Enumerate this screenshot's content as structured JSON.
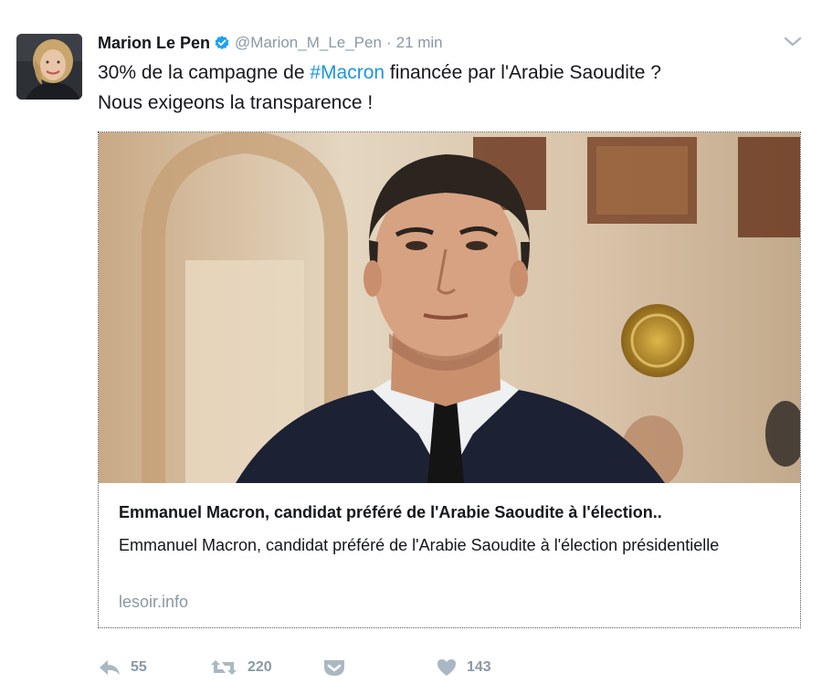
{
  "tweet": {
    "author_name": "Marion Le Pen",
    "handle": "@Marion_M_Le_Pen",
    "separator": "·",
    "time": "21 min",
    "text_before": "30% de la campagne de ",
    "hashtag": "#Macron",
    "text_line1_after": " financée par l'Arabie Saoudite ?",
    "text_line2": "Nous exigeons la transparence !"
  },
  "card": {
    "title": "Emmanuel Macron, candidat préféré de l'Arabie Saoudite à l'élection..",
    "description": "Emmanuel Macron, candidat préféré de l'Arabie Saoudite à l'élection présidentielle",
    "domain": "lesoir.info"
  },
  "actions": {
    "reply_count": "55",
    "retweet_count": "220",
    "like_count": "143"
  },
  "icons": {
    "verified": "verified-badge-icon",
    "caret": "chevron-down-icon",
    "reply": "reply-icon",
    "retweet": "retweet-icon",
    "pocket": "pocket-save-icon",
    "like": "heart-icon"
  },
  "colors": {
    "link_blue": "#1b95e0",
    "muted_gray": "#8899a6",
    "action_gray": "#aab8c2",
    "text": "#14171a"
  }
}
